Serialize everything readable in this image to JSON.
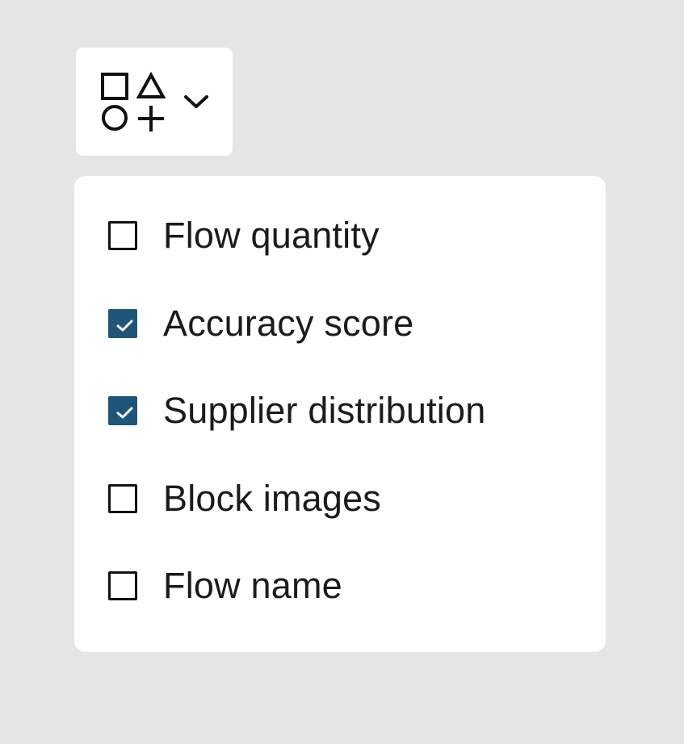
{
  "toolbar": {
    "shape_toggle_icon": "shapes-icon",
    "dropdown_icon": "chevron-down-icon"
  },
  "menu": {
    "options": [
      {
        "label": "Flow quantity",
        "checked": false
      },
      {
        "label": "Accuracy score",
        "checked": true
      },
      {
        "label": "Supplier distribution",
        "checked": true
      },
      {
        "label": "Block images",
        "checked": false
      },
      {
        "label": "Flow name",
        "checked": false
      }
    ]
  },
  "colors": {
    "background": "#e5e5e5",
    "panel": "#ffffff",
    "checkbox_checked": "#1f5577",
    "checkbox_border": "#111111",
    "text": "#1b1b1b"
  }
}
